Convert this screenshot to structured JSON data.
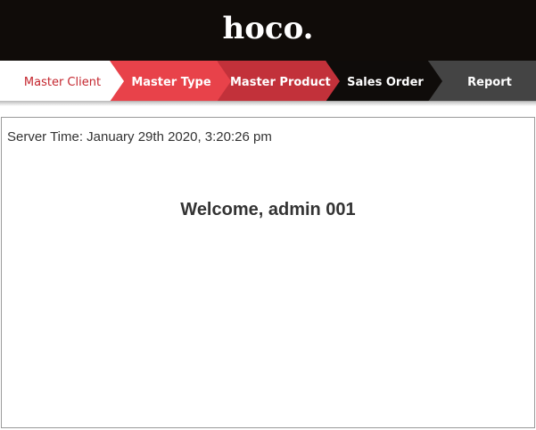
{
  "header": {
    "logo_text": "hoco."
  },
  "nav": {
    "items": [
      {
        "label": "Master Client",
        "color": "#ffffff",
        "text_color": "#c4262e"
      },
      {
        "label": "Master Type",
        "color": "#e8424a"
      },
      {
        "label": "Master Product",
        "color": "#c2313a"
      },
      {
        "label": "Sales Order",
        "color": "#0f0c0a"
      },
      {
        "label": "Report",
        "color": "#444444"
      }
    ]
  },
  "main": {
    "server_time": "Server Time: January 29th 2020, 3:20:26 pm",
    "welcome": "Welcome, admin 001"
  }
}
